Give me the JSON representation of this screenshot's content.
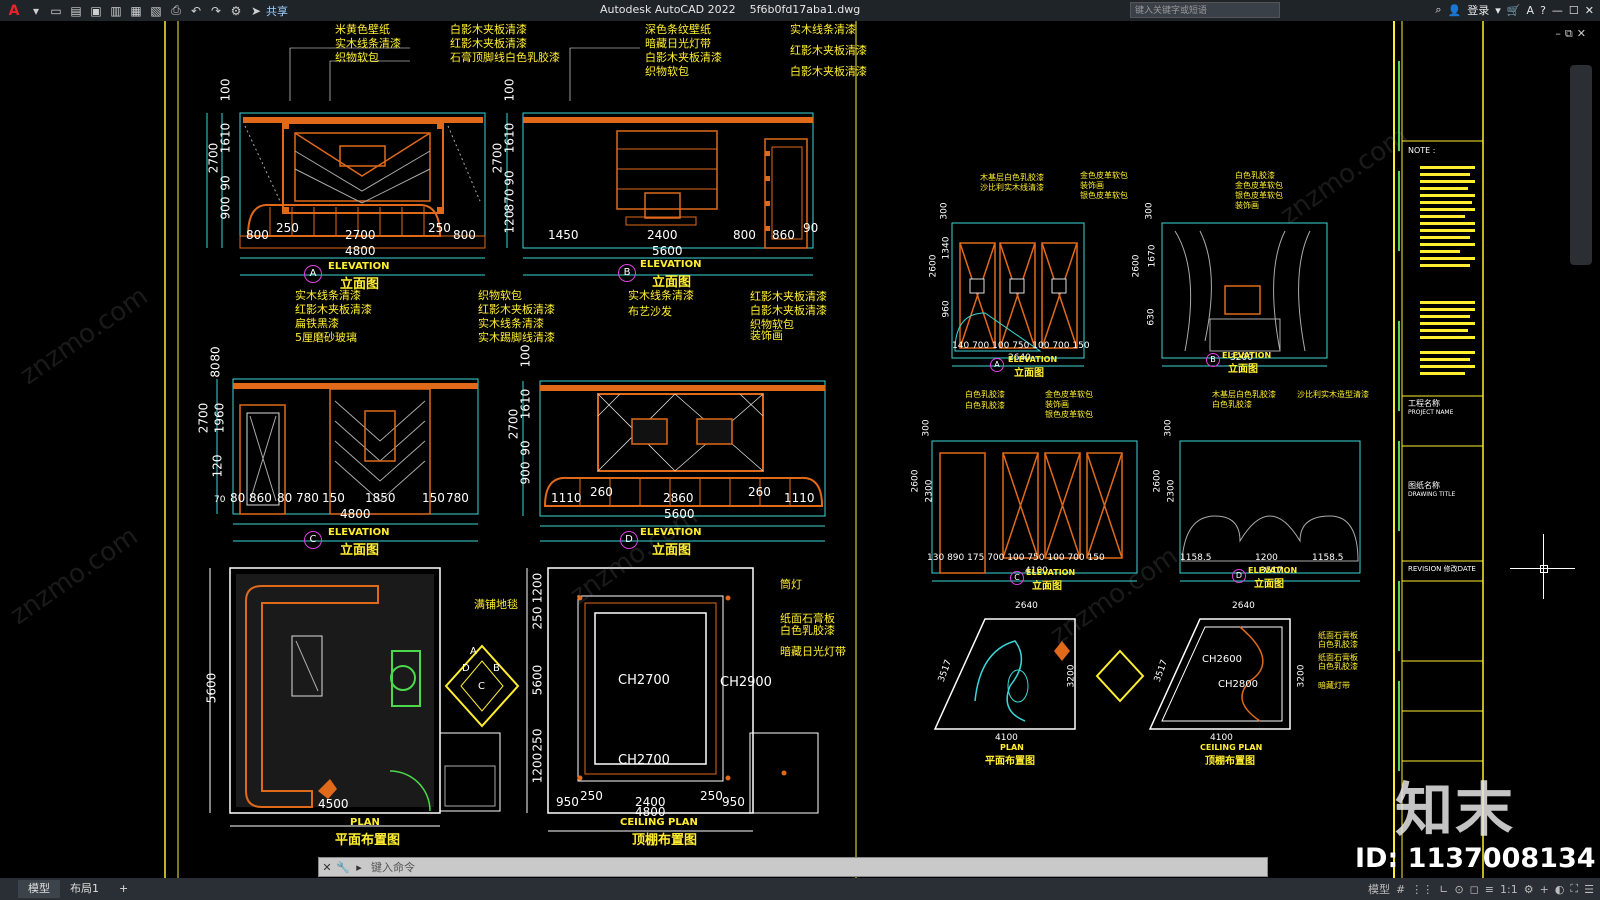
{
  "titlebar": {
    "app_icon": "autocad-logo",
    "app_title": "Autodesk AutoCAD 2022",
    "file_name": "5f6b0fd17aba1.dwg",
    "share_label": "共享",
    "search_placeholder": "键入关键字或短语",
    "login_label": "登录"
  },
  "commandline": {
    "placeholder": "键入命令"
  },
  "statusbar": {
    "tabs": [
      "模型",
      "布局1"
    ],
    "model_label": "模型",
    "scale": "1:1"
  },
  "watermark": {
    "brand": "知末",
    "site": "znzmo.com",
    "id_label": "ID: 1137008134"
  },
  "left": {
    "A": {
      "ann_left": [
        "米黄色壁纸",
        "实木线条清漆",
        "织物软包"
      ],
      "ann_mid": [
        "白影木夹板清漆",
        "红影木夹板清漆",
        "石膏顶脚线白色乳胶漆"
      ],
      "dims_v": [
        "100",
        "1610",
        "90",
        "900",
        "2700"
      ],
      "dims_h": [
        "800",
        "250",
        "2700",
        "250",
        "800"
      ],
      "total": "4800"
    },
    "B": {
      "ann": [
        "深色条纹壁纸",
        "暗藏日光灯带",
        "白影木夹板清漆",
        "织物软包"
      ],
      "ann_right": [
        "实木线条清漆",
        "红影木夹板清漆",
        "白影木夹板清漆"
      ],
      "dims_v": [
        "100",
        "1610",
        "90",
        "870",
        "120",
        "2700"
      ],
      "dims_h": [
        "1450",
        "2400",
        "800",
        "860",
        "90"
      ],
      "total": "5600"
    },
    "C": {
      "ann": [
        "实木线条清漆",
        "红影木夹板清漆",
        "扁铁黑漆",
        "5厘磨砂玻璃"
      ],
      "ann_mid": [
        "织物软包",
        "红影木夹板清漆",
        "实木线条清漆",
        "实木踢脚线清漆"
      ],
      "dims_v": [
        "80",
        "80",
        "1960",
        "120",
        "2700",
        "70"
      ],
      "dims_h": [
        "80",
        "860",
        "80",
        "780",
        "150",
        "1850",
        "150",
        "780"
      ],
      "total": "4800"
    },
    "D": {
      "ann": [
        "实木线条清漆",
        "布艺沙发"
      ],
      "ann_right": [
        "红影木夹板清漆",
        "白影木夹板清漆",
        "织物软包",
        "装饰画"
      ],
      "dims_v": [
        "100",
        "1610",
        "90",
        "900",
        "2700"
      ],
      "dims_h": [
        "1110",
        "260",
        "2860",
        "260",
        "1110"
      ],
      "total": "5600"
    },
    "elevation_label": "ELEVATION",
    "elevation_cn": "立面图",
    "plan": {
      "ann": "满铺地毯",
      "dim_v": "5600",
      "dim_h": "4500",
      "label": "PLAN",
      "label_cn": "平面布置图"
    },
    "ceiling": {
      "ann": [
        "筒灯",
        "纸面石膏板",
        "白色乳胶漆",
        "暗藏日光灯带"
      ],
      "ch": [
        "CH2700",
        "CH2900",
        "CH2700"
      ],
      "dims_v": [
        "1200",
        "250",
        "5600",
        "250",
        "1200"
      ],
      "dims_h": [
        "950",
        "250",
        "2400",
        "250",
        "950"
      ],
      "total": "4800",
      "label": "CEILING PLAN",
      "label_cn": "顶棚布置图"
    }
  },
  "right": {
    "A": {
      "ann": [
        "木基层白色乳胶漆",
        "沙比利实木线清漆",
        "金色皮革软包",
        "装饰画",
        "银色皮革软包"
      ],
      "dims_v": [
        "300",
        "1340",
        "960",
        "2600"
      ],
      "dims_h": [
        "140",
        "700",
        "100",
        "750",
        "100",
        "700",
        "150"
      ],
      "total": "2640"
    },
    "B": {
      "ann": [
        "白色乳胶漆",
        "金色皮革软包",
        "银色皮革软包",
        "装饰画"
      ],
      "dims_v": [
        "300",
        "1670",
        "630",
        "2600"
      ],
      "total": "3200"
    },
    "C": {
      "ann": [
        "白色乳胶漆",
        "白色乳胶漆",
        "金色皮革软包",
        "装饰画",
        "银色皮革软包"
      ],
      "dims_v": [
        "300",
        "2300",
        "2600"
      ],
      "dims_h": [
        "130",
        "890",
        "175",
        "700",
        "100",
        "750",
        "100",
        "700",
        "150"
      ],
      "total": "4100"
    },
    "D": {
      "ann": [
        "木基层白色乳胶漆",
        "白色乳胶漆",
        "沙比利实木造型清漆"
      ],
      "dims_v": [
        "300",
        "2300",
        "2600"
      ],
      "dims_h": [
        "1158.5",
        "1200",
        "1158.5"
      ],
      "total": "3517"
    },
    "plan": {
      "dims": [
        "2640",
        "3517",
        "3200",
        "4100"
      ],
      "label": "PLAN",
      "label_cn": "平面布置图"
    },
    "ceiling": {
      "dims": [
        "2640",
        "3517",
        "3200",
        "4100"
      ],
      "ch": [
        "CH2600",
        "CH2800"
      ],
      "ann": [
        "纸面石膏板",
        "白色乳胶漆",
        "纸面石膏板",
        "白色乳胶漆",
        "暗藏灯带"
      ],
      "label": "CEILING PLAN",
      "label_cn": "顶棚布置图"
    }
  },
  "titleblock": {
    "note": "NOTE :",
    "project": "工程名称",
    "project_en": "PROJECT NAME",
    "drawing": "图纸名称",
    "drawing_en": "DRAWING TITLE",
    "revision": "REVISION 修改DATE"
  }
}
